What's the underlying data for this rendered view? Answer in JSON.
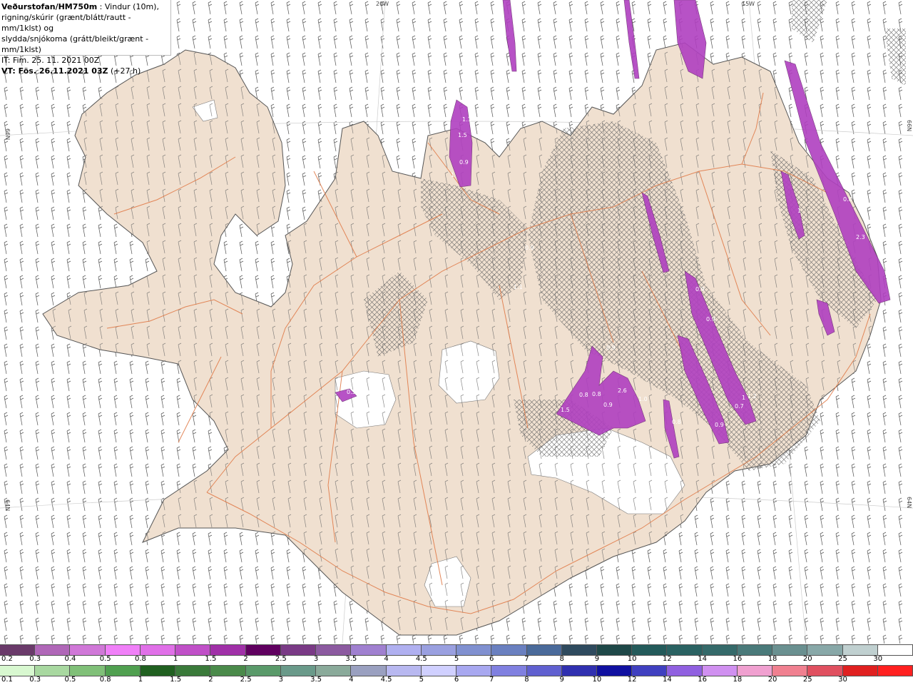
{
  "header": {
    "title": "Veðurstofan/HM750m",
    "desc1": " : Vindur (10m),",
    "desc2": "rigning/skúrir (grænt/blátt/rautt - mm/1klst) og",
    "desc3": "slydda/snjókoma (grátt/bleikt/grænt - mm/1klst)",
    "it": "IT: Fim. 25. 11. 2021 00Z",
    "vt": "VT: Fös. 26.11.2021 03Z",
    "vt_suffix": " (+27 h)"
  },
  "axes": {
    "top_left": "20W",
    "top_right": "15W",
    "left_upper": "66N",
    "left_lower": "64N",
    "right_upper": "66N",
    "right_lower": "64N"
  },
  "map_labels": [
    "1.5",
    "0.9",
    "1",
    "1.1",
    "0.9",
    "1.1",
    "0.9",
    "2.3",
    "1",
    "0.8",
    "1",
    "0.9",
    "2.6",
    "1.0",
    "0.9",
    "0.8",
    "1.2",
    "0.9",
    "0.7",
    "0.8",
    "0.5",
    "0.9",
    "0.8",
    "1.5"
  ],
  "colors": {
    "land": "#f0e0d0",
    "roads": "#e07c4a",
    "coast": "#555555",
    "precip": "#b040c0"
  },
  "legend": {
    "snow_labels": [
      "0.2",
      "0.3",
      "0.4",
      "0.5",
      "0.8",
      "1",
      "1.5",
      "2",
      "2.5",
      "3",
      "3.5",
      "4",
      "4.5",
      "5",
      "6",
      "7",
      "8",
      "9",
      "10",
      "12",
      "14",
      "16",
      "18",
      "20",
      "25",
      "30"
    ],
    "snow_colors": [
      "#6a3a6a",
      "#b067b8",
      "#d078d8",
      "#f080f8",
      "#e070e8",
      "#c050c8",
      "#a030a8",
      "#600060",
      "#7a3a86",
      "#8c5aa0",
      "#a080d0",
      "#b0b0f0",
      "#9aa0e0",
      "#8090d0",
      "#6a80c0",
      "#4a6a9a",
      "#2e4a5e",
      "#1e4848",
      "#235a5a",
      "#2a6262",
      "#356a6a",
      "#4a7a7a",
      "#6a9090",
      "#88a8a8",
      "#c0d0d0",
      "#ffffff"
    ],
    "rain_labels": [
      "0.1",
      "0.3",
      "0.5",
      "0.8",
      "1",
      "1.5",
      "2",
      "2.5",
      "3",
      "3.5",
      "4",
      "4.5",
      "5",
      "6",
      "7",
      "8",
      "9",
      "10",
      "12",
      "14",
      "16",
      "18",
      "20",
      "25",
      "30"
    ],
    "rain_colors": [
      "#d8f8d0",
      "#a8d8a0",
      "#80c078",
      "#50a050",
      "#206020",
      "#3a7a3a",
      "#4a8a4a",
      "#5a9a6a",
      "#6a9a8a",
      "#8aaa9a",
      "#9aa0c0",
      "#b8b8f0",
      "#d0d0ff",
      "#a8a8f0",
      "#8080e0",
      "#6060d0",
      "#3030b0",
      "#1010a0",
      "#4040c0",
      "#9060e0",
      "#d090f0",
      "#f0a0d0",
      "#f08090",
      "#e05060",
      "#e02020",
      "#ff2020"
    ]
  }
}
